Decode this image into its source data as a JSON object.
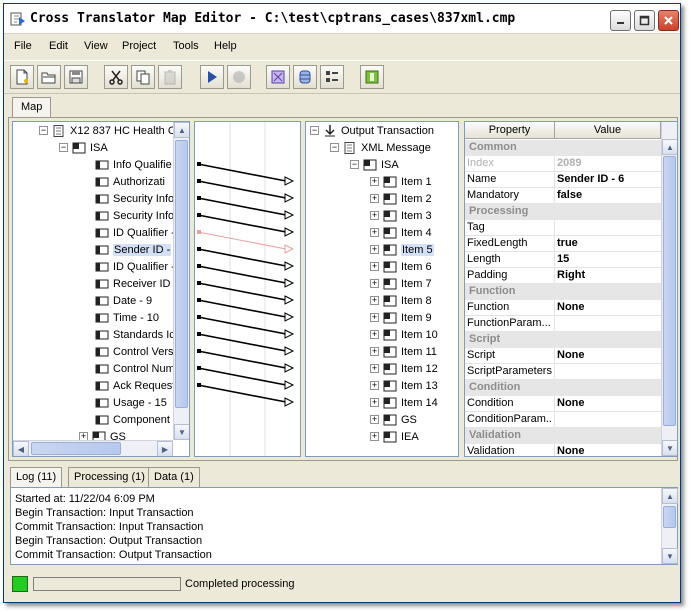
{
  "window": {
    "title": "Cross Translator Map Editor - C:\\test\\cptrans_cases\\837xml.cmp"
  },
  "menu": [
    "File",
    "Edit",
    "View",
    "Project",
    "Tools",
    "Help"
  ],
  "toolbar_icons": [
    "new-file-icon",
    "open-folder-icon",
    "save-icon",
    "cut-icon",
    "copy-icon",
    "paste-icon",
    "run-icon",
    "stop-icon",
    "map-icon",
    "database-icon",
    "properties-icon",
    "exit-icon"
  ],
  "map_tab": "Map",
  "input_tree": {
    "root": "X12 837 HC Health C",
    "group": "ISA",
    "items": [
      "Info Qualifie",
      "Authorizati",
      "Security Info",
      "Security Info",
      "ID Qualifier -",
      "Sender ID -",
      "ID Qualifier -",
      "Receiver ID",
      "Date - 9",
      "Time - 10",
      "Standards Ic",
      "Control Vers",
      "Control Num",
      "Ack Request",
      "Usage - 15",
      "Component"
    ],
    "selected_index": 5,
    "tail": "GS"
  },
  "output_tree": {
    "root": "Output Transaction",
    "message": "XML Message",
    "group": "ISA",
    "items": [
      "Item 1",
      "Item 2",
      "Item 3",
      "Item 4",
      "Item 5",
      "Item 6",
      "Item 7",
      "Item 8",
      "Item 9",
      "Item 10",
      "Item 11",
      "Item 12",
      "Item 13",
      "Item 14"
    ],
    "selected_index": 4,
    "tail": [
      "GS",
      "IEA"
    ]
  },
  "properties": {
    "headers": [
      "Property",
      "Value"
    ],
    "rows": [
      {
        "type": "group",
        "label": "Common"
      },
      {
        "type": "row",
        "key": "Index",
        "value": "2089",
        "disabled": true
      },
      {
        "type": "row",
        "key": "Name",
        "value": "Sender ID - 6"
      },
      {
        "type": "row",
        "key": "Mandatory",
        "value": "false"
      },
      {
        "type": "group",
        "label": "Processing"
      },
      {
        "type": "row",
        "key": "Tag",
        "value": ""
      },
      {
        "type": "row",
        "key": "FixedLength",
        "value": "true"
      },
      {
        "type": "row",
        "key": "Length",
        "value": "15"
      },
      {
        "type": "row",
        "key": "Padding",
        "value": "Right"
      },
      {
        "type": "group",
        "label": "Function"
      },
      {
        "type": "row",
        "key": "Function",
        "value": "None"
      },
      {
        "type": "row",
        "key": "FunctionParam...",
        "value": ""
      },
      {
        "type": "group",
        "label": "Script"
      },
      {
        "type": "row",
        "key": "Script",
        "value": "None"
      },
      {
        "type": "row",
        "key": "ScriptParameters",
        "value": ""
      },
      {
        "type": "group",
        "label": "Condition"
      },
      {
        "type": "row",
        "key": "Condition",
        "value": "None"
      },
      {
        "type": "row",
        "key": "ConditionParam...",
        "value": ""
      },
      {
        "type": "group",
        "label": "Validation"
      },
      {
        "type": "row",
        "key": "Validation",
        "value": "None"
      }
    ]
  },
  "log_tabs": [
    "Log (11)",
    "Processing (1)",
    "Data (1)"
  ],
  "log_lines": [
    "Started at: 11/22/04 6:09 PM",
    "Begin Transaction: Input Transaction",
    "Commit Transaction: Input Transaction",
    "Begin Transaction: Output Transaction",
    "Commit Transaction: Output Transaction"
  ],
  "status": {
    "text": "Completed processing",
    "progress": 0,
    "led_color": "#22cc22"
  }
}
